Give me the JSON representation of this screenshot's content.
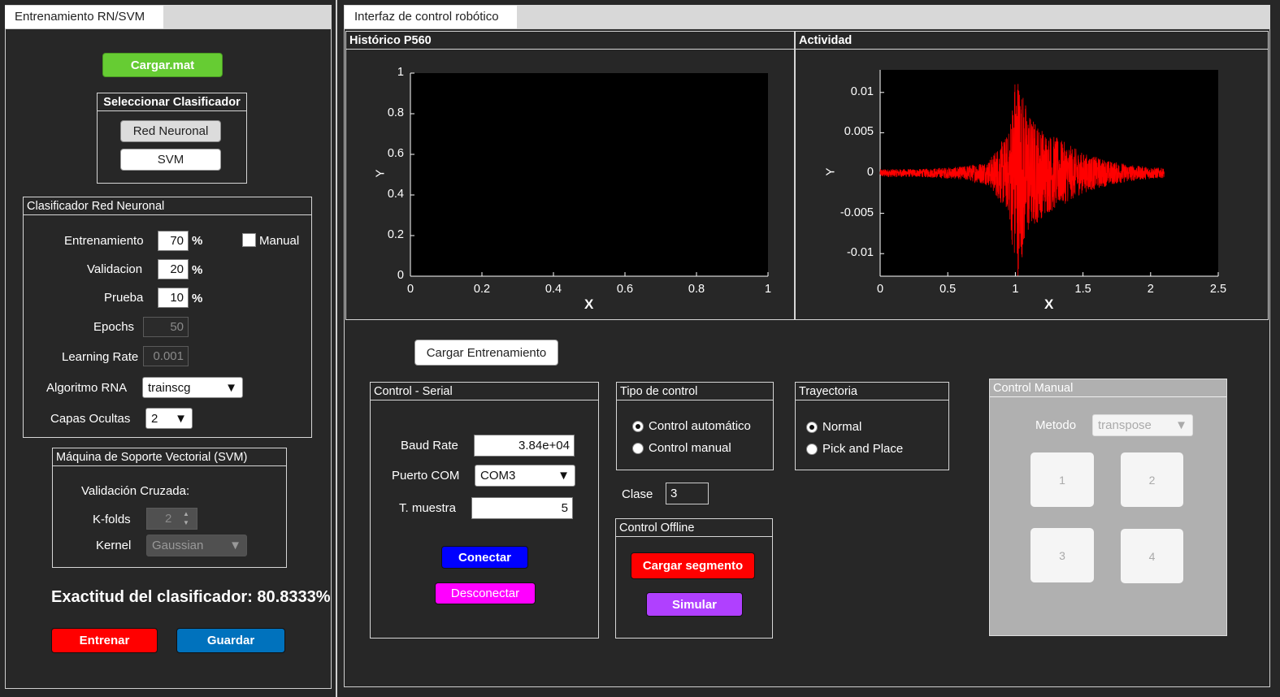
{
  "left_panel": {
    "tab": "Entrenamiento RN/SVM",
    "load_button": "Cargar.mat",
    "select_classifier": {
      "title": "Seleccionar Clasificador",
      "neural_button": "Red Neuronal",
      "svm_button": "SVM"
    },
    "nn_panel": {
      "title": "Clasificador Red Neuronal",
      "training_label": "Entrenamiento",
      "training_value": "70",
      "validation_label": "Validacion",
      "validation_value": "20",
      "test_label": "Prueba",
      "test_value": "10",
      "percent": "%",
      "manual_label": "Manual",
      "epochs_label": "Epochs",
      "epochs_value": "50",
      "lr_label": "Learning Rate",
      "lr_value": "0.001",
      "algorithm_label": "Algoritmo RNA",
      "algorithm_value": "trainscg",
      "hidden_label": "Capas Ocultas",
      "hidden_value": "2"
    },
    "svm_panel": {
      "title": "Máquina de Soporte Vectorial (SVM)",
      "cv_label": "Validación Cruzada:",
      "kfolds_label": "K-folds",
      "kfolds_value": "2",
      "kernel_label": "Kernel",
      "kernel_value": "Gaussian"
    },
    "accuracy_text": "Exactitud del clasificador: 80.8333%",
    "train_button": "Entrenar",
    "save_button": "Guardar"
  },
  "right_panel": {
    "tab": "Interfaz de control robótico",
    "plot1_title": "Histórico P560",
    "plot2_title": "Actividad",
    "load_training_button": "Cargar Entrenamiento",
    "serial": {
      "title": "Control - Serial",
      "baud_label": "Baud Rate",
      "baud_value": "3.84e+04",
      "port_label": "Puerto COM",
      "port_value": "COM3",
      "sample_label": "T. muestra",
      "sample_value": "5",
      "connect_button": "Conectar",
      "disconnect_button": "Desconectar"
    },
    "control_type": {
      "title": "Tipo de control",
      "opt_auto": "Control automático",
      "opt_manual": "Control manual"
    },
    "class_label": "Clase",
    "class_value": "3",
    "offline": {
      "title": "Control Offline",
      "load_segment_button": "Cargar segmento",
      "simulate_button": "Simular"
    },
    "trajectory": {
      "title": "Trayectoria",
      "opt_normal": "Normal",
      "opt_pick": "Pick and Place"
    },
    "manual_control": {
      "title": "Control Manual",
      "method_label": "Metodo",
      "method_value": "transpose",
      "buttons": [
        "1",
        "2",
        "3",
        "4"
      ]
    }
  },
  "colors": {
    "background": "#272727",
    "load_mat_green": "#66cc33",
    "train_red": "#ff0000",
    "save_blue": "#0072bd",
    "connect_blue": "#0000ff",
    "disconnect_magenta": "#ff00ff",
    "simulate_purple": "#b040ff",
    "signal_red": "#ff0000"
  },
  "icons": {
    "dropdown": "chevron-down-icon",
    "spinner": "spinner-arrows-icon"
  },
  "chart_data": [
    {
      "type": "line",
      "title": "Histórico P560",
      "xlabel": "X",
      "ylabel": "Y",
      "xlim": [
        0,
        1
      ],
      "ylim": [
        0,
        1
      ],
      "xticks": [
        "0",
        "0.2",
        "0.4",
        "0.6",
        "0.8",
        "1"
      ],
      "yticks": [
        "0",
        "0.2",
        "0.4",
        "0.6",
        "0.8",
        "1"
      ],
      "series": []
    },
    {
      "type": "line",
      "title": "Actividad",
      "xlabel": "X",
      "ylabel": "Y",
      "xlim": [
        0,
        2.5
      ],
      "ylim": [
        -0.0128,
        0.0128
      ],
      "xticks": [
        "0",
        "0.5",
        "1",
        "1.5",
        "2",
        "2.5"
      ],
      "yticks": [
        "0.01",
        "0.005",
        "0",
        "-0.005",
        "-0.01"
      ],
      "series": [
        {
          "color": "#ff0000",
          "envelope": {
            "x": [
              0,
              0.3,
              0.6,
              0.8,
              0.9,
              0.95,
              1.0,
              1.02,
              1.05,
              1.1,
              1.2,
              1.3,
              1.5,
              1.7,
              1.9,
              2.1
            ],
            "amplitude": [
              0.0005,
              0.0005,
              0.0008,
              0.0015,
              0.004,
              0.005,
              0.0128,
              0.0128,
              0.0105,
              0.0075,
              0.0055,
              0.0045,
              0.0025,
              0.0015,
              0.0009,
              0.0006
            ]
          }
        }
      ]
    }
  ]
}
